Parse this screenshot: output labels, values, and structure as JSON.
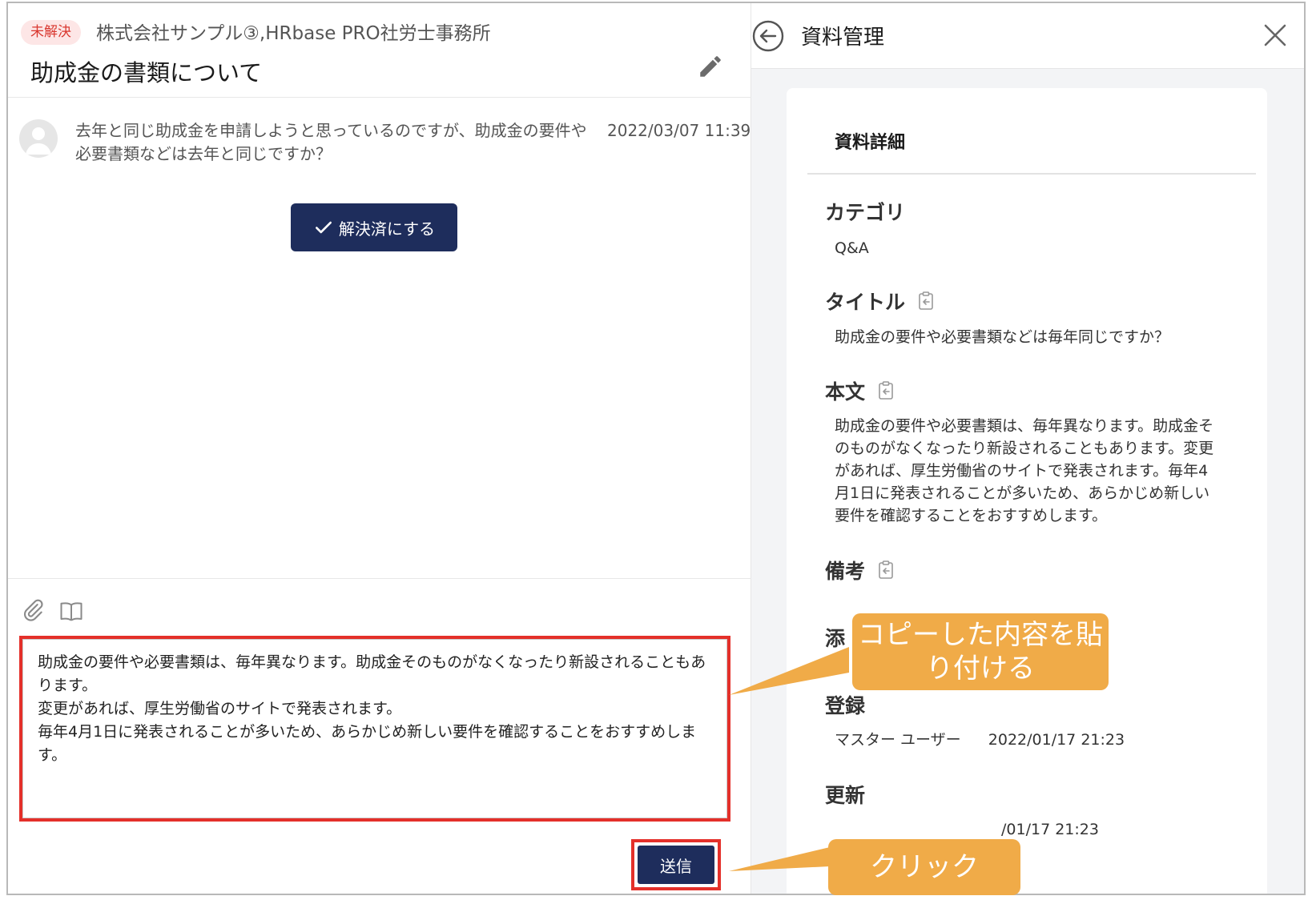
{
  "thread": {
    "status_badge": "未解決",
    "company": "株式会社サンプル③,HRbase PRO社労士事務所",
    "title": "助成金の書類について"
  },
  "message": {
    "text": "去年と同じ助成金を申請しようと思っているのですが、助成金の要件や必要書類などは去年と同じですか？",
    "time": "2022/03/07 11:39"
  },
  "resolve_button": "解決済にする",
  "reply": {
    "value": "助成金の要件や必要書類は、毎年異なります。助成金そのものがなくなったり新設されることもあります。\n変更があれば、厚生労働省のサイトで発表されます。\n毎年4月1日に発表されることが多いため、あらかじめ新しい要件を確認することをおすすめします。"
  },
  "send_button": "送信",
  "panel": {
    "title": "資料管理",
    "card_title": "資料詳細",
    "category_label": "カテゴリ",
    "category_value": "Q&A",
    "title_label": "タイトル",
    "title_value": "助成金の要件や必要書類などは毎年同じですか？",
    "body_label": "本文",
    "body_value": "助成金の要件や必要書類は、毎年異なります。助成金そのものがなくなったり新設されることもあります。変更があれば、厚生労働省のサイトで発表されます。毎年4月1日に発表されることが多いため、あらかじめ新しい要件を確認することをおすすめします。",
    "notes_label": "備考",
    "attach_label": "添",
    "registered_label": "登録",
    "registered_user": "マスター ユーザー",
    "registered_time": "2022/01/17 21:23",
    "updated_label": "更新",
    "updated_time": "/01/17 21:23"
  },
  "callouts": {
    "paste": "コピーした内容を貼り付ける",
    "click": "クリック"
  },
  "colors": {
    "primary": "#1e2d5c",
    "highlight": "#e4302a",
    "callout": "#f0ab48",
    "badge_bg": "#fde6e6",
    "badge_text": "#d9372f"
  }
}
